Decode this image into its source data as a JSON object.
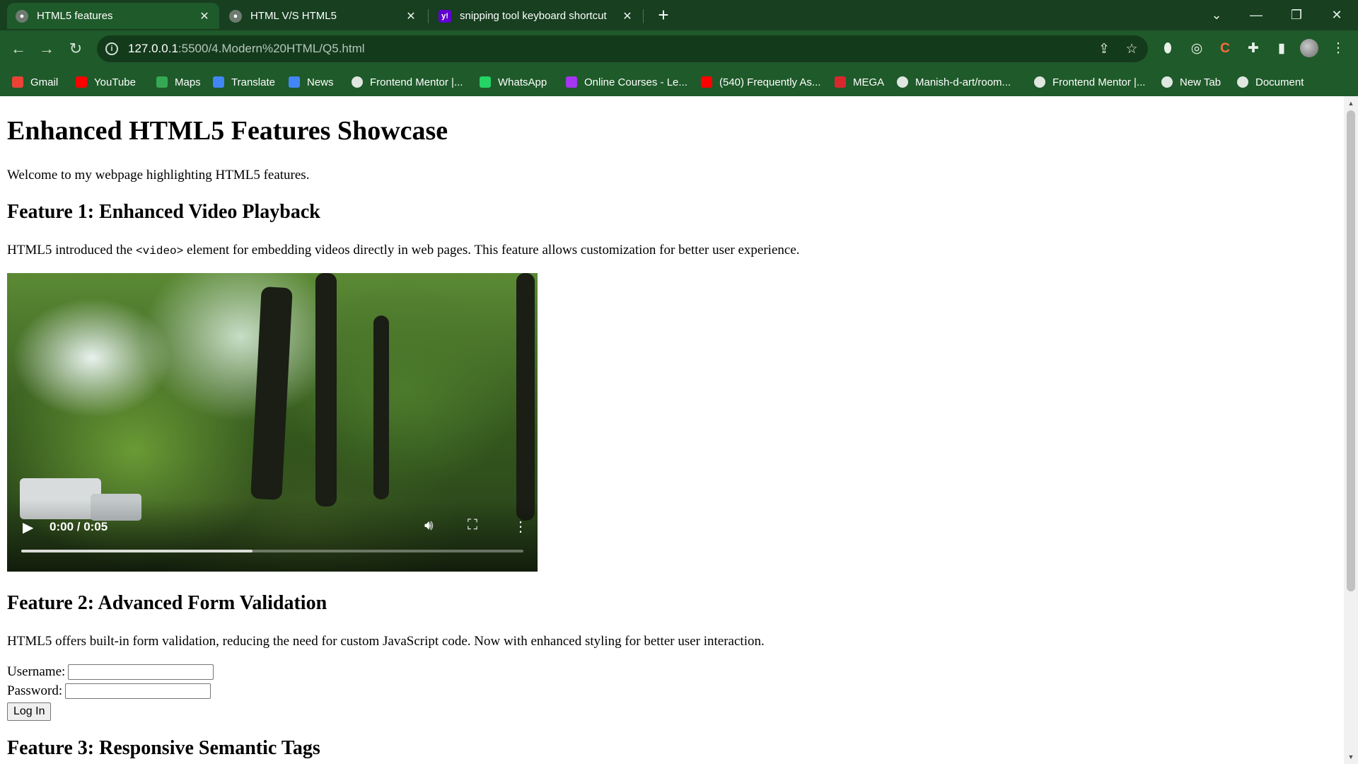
{
  "browser": {
    "tabs": [
      {
        "title": "HTML5 features",
        "active": true
      },
      {
        "title": "HTML V/S HTML5",
        "active": false
      },
      {
        "title": "snipping tool keyboard shortcut",
        "active": false
      }
    ],
    "url_host": "127.0.0.1",
    "url_rest": ":5500/4.Modern%20HTML/Q5.html",
    "bookmarks": [
      {
        "label": "Gmail",
        "icon": "gmail-icon",
        "color": "#ea4335"
      },
      {
        "label": "YouTube",
        "icon": "youtube-icon",
        "color": "#ff0000"
      },
      {
        "label": "Maps",
        "icon": "maps-icon",
        "color": "#34a853"
      },
      {
        "label": "Translate",
        "icon": "translate-icon",
        "color": "#4285f4"
      },
      {
        "label": "News",
        "icon": "news-icon",
        "color": "#4285f4"
      },
      {
        "label": "Frontend Mentor |...",
        "icon": "frontend-mentor-icon",
        "color": "#ffffff"
      },
      {
        "label": "WhatsApp",
        "icon": "whatsapp-icon",
        "color": "#25d366"
      },
      {
        "label": "Online Courses - Le...",
        "icon": "udemy-icon",
        "color": "#a435f0"
      },
      {
        "label": "(540) Frequently As...",
        "icon": "youtube-icon",
        "color": "#ff0000"
      },
      {
        "label": "MEGA",
        "icon": "mega-icon",
        "color": "#d9272e"
      },
      {
        "label": "Manish-d-art/room...",
        "icon": "github-icon",
        "color": "#ffffff"
      },
      {
        "label": "Frontend Mentor |...",
        "icon": "globe-icon",
        "color": "#ffffff"
      },
      {
        "label": "New Tab",
        "icon": "globe-icon",
        "color": "#ffffff"
      },
      {
        "label": "Document",
        "icon": "globe-icon",
        "color": "#ffffff"
      }
    ],
    "theme_color": "#1f5a2a"
  },
  "page": {
    "title": "Enhanced HTML5 Features Showcase",
    "intro": "Welcome to my webpage highlighting HTML5 features.",
    "feature1": {
      "heading": "Feature 1: Enhanced Video Playback",
      "text_before": "HTML5 introduced the ",
      "code": "<video>",
      "text_after": " element for embedding videos directly in web pages. This feature allows customization for better user experience."
    },
    "video": {
      "time": "0:00 / 0:05",
      "buffered_fraction": 0.46
    },
    "feature2": {
      "heading": "Feature 2: Advanced Form Validation",
      "text": "HTML5 offers built-in form validation, reducing the need for custom JavaScript code. Now with enhanced styling for better user interaction."
    },
    "form": {
      "username_label": "Username:",
      "username_value": "",
      "password_label": "Password:",
      "password_value": "",
      "submit_label": "Log In"
    },
    "feature3": {
      "heading": "Feature 3: Responsive Semantic Tags"
    }
  }
}
